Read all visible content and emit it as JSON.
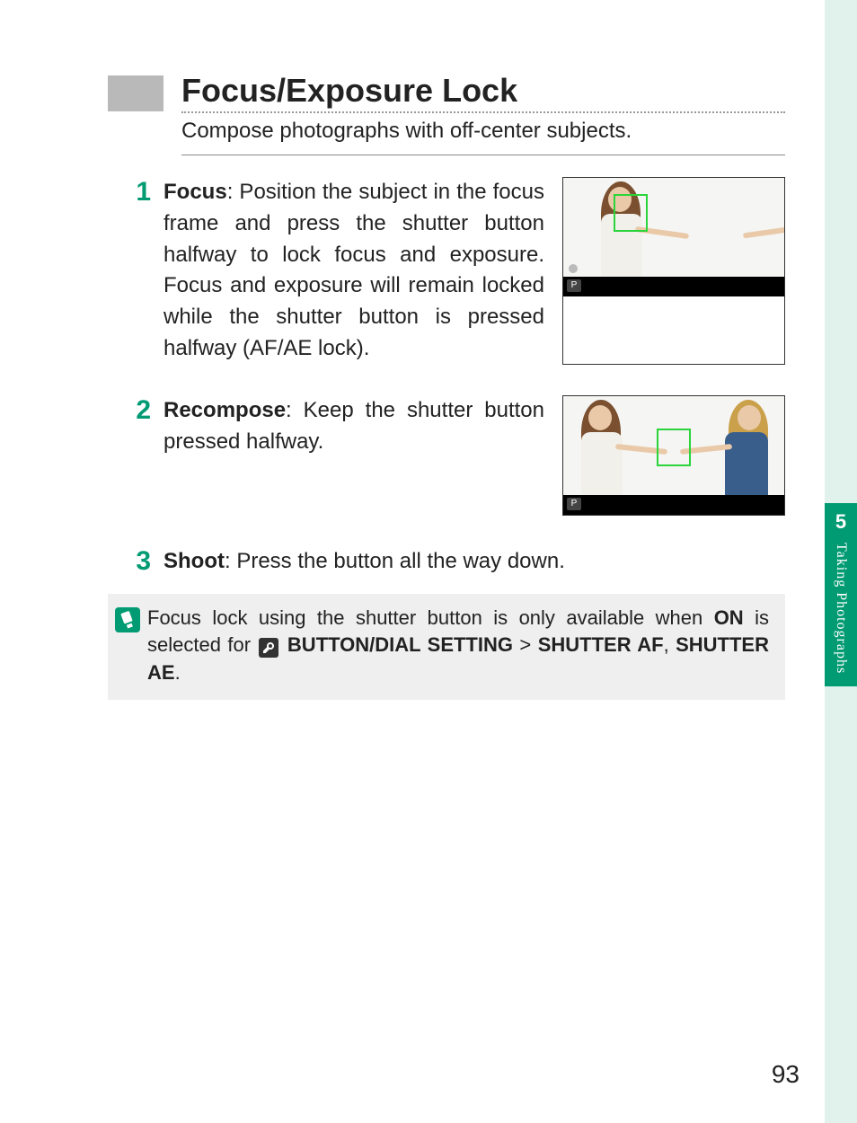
{
  "side_tab": {
    "chapter_number": "5",
    "chapter_title": "Taking Photographs"
  },
  "header": {
    "title": "Focus/Exposure Lock",
    "subtitle": "Compose photographs with off-center subjects."
  },
  "steps": [
    {
      "num": "1",
      "lead": "Focus",
      "text": ": Position the subject in the focus frame and press the shutter button halfway to lock focus and exposure. Focus and exposure will remain locked while the shutter button is pressed halfway (AF/AE lock)."
    },
    {
      "num": "2",
      "lead": "Recompose",
      "text": ": Keep the shutter button pressed halfway."
    },
    {
      "num": "3",
      "lead": "Shoot",
      "text": ": Press the button all the way down."
    }
  ],
  "thumbs": {
    "mode_badge": "P"
  },
  "note": {
    "pre": "Focus lock using the shutter button is only available when ",
    "on": "ON",
    "mid": " is selected for ",
    "setting": "BUTTON/DIAL SETTING",
    "gt": " > ",
    "s1": "SHUTTER AF",
    "comma": ", ",
    "s2": "SHUTTER AE",
    "end": "."
  },
  "page_number": "93"
}
